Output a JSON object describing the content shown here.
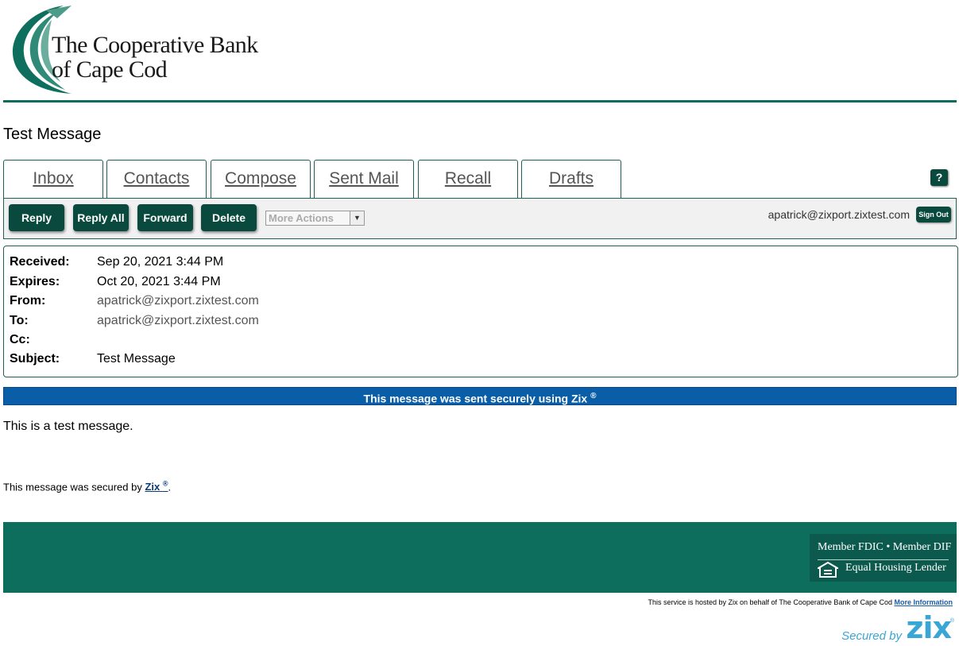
{
  "brand": {
    "line1": "The Cooperative Bank",
    "line2": "of Cape Cod",
    "primary_color": "#0d6e5e",
    "button_color": "#0a4a3e"
  },
  "page_title": "Test Message",
  "tabs": [
    {
      "label": "Inbox"
    },
    {
      "label": "Contacts"
    },
    {
      "label": "Compose"
    },
    {
      "label": "Sent Mail"
    },
    {
      "label": "Recall"
    },
    {
      "label": "Drafts"
    }
  ],
  "help_label": "?",
  "toolbar": {
    "reply": "Reply",
    "reply_all": "Reply All",
    "forward": "Forward",
    "delete": "Delete",
    "more_actions": "More Actions",
    "user_email": "apatrick@zixport.zixtest.com",
    "sign_out": "Sign Out"
  },
  "message": {
    "received_label": "Received:",
    "received": "Sep 20, 2021 3:44 PM",
    "expires_label": "Expires:",
    "expires": "Oct 20, 2021 3:44 PM",
    "from_label": "From:",
    "from": "apatrick@zixport.zixtest.com",
    "to_label": "To:",
    "to": "apatrick@zixport.zixtest.com",
    "cc_label": "Cc:",
    "cc": "",
    "subject_label": "Subject:",
    "subject": "Test Message",
    "body": "This is a test message."
  },
  "secure_banner": {
    "text": "This message was sent securely using Zix",
    "reg": "®",
    "color": "#0a5ea8"
  },
  "secured_by": {
    "prefix": "This message was secured by",
    "link": "Zix",
    "reg": "®",
    "suffix": "."
  },
  "footer": {
    "fdic_line": "Member FDIC • Member DIF",
    "ehl_line": "Equal Housing Lender",
    "hosted_text": "This service is hosted by Zix on behalf of The Cooperative Bank of Cape Cod",
    "more_info": "More Information",
    "secured_by_label": "Secured by",
    "zix_logo": "zix",
    "zix_reg": "®",
    "zix_color": "#3aa6d6"
  }
}
